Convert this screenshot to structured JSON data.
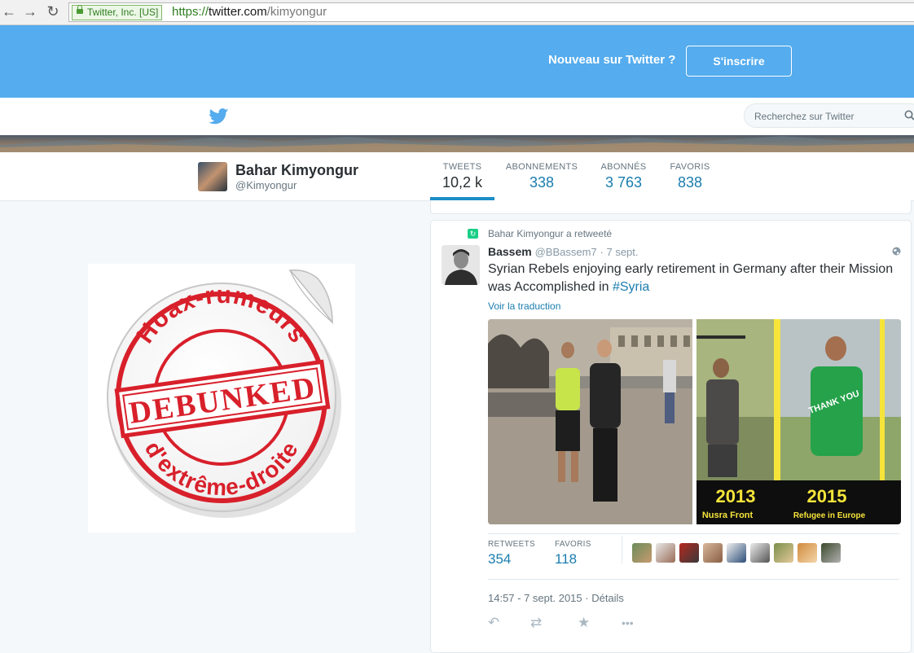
{
  "browser": {
    "ev_badge": "Twitter, Inc. [US]",
    "url_scheme": "https://",
    "url_host": "twitter.com",
    "url_path": "/kimyongur",
    "icons": [
      "back-arrow-icon",
      "forward-arrow-icon",
      "reload-icon",
      "lock-icon"
    ]
  },
  "signup": {
    "prompt": "Nouveau sur Twitter ?",
    "button": "S'inscrire",
    "color": "#55acee"
  },
  "topnav": {
    "search_placeholder": "Recherchez sur Twitter",
    "logo_color": "#55acee"
  },
  "profile": {
    "name": "Bahar Kimyongur",
    "handle": "@Kimyongur",
    "stats": [
      {
        "label": "TWEETS",
        "value": "10,2 k"
      },
      {
        "label": "ABONNEMENTS",
        "value": "338"
      },
      {
        "label": "ABONNÉS",
        "value": "3 763"
      },
      {
        "label": "FAVORIS",
        "value": "838"
      }
    ],
    "active_tab": "TWEETS"
  },
  "sticker": {
    "top_arc": "Hoax-rumeurs",
    "center": "DEBUNKED",
    "bottom_arc": "d'extrême-droite",
    "ink_color": "#d8202b"
  },
  "tweet": {
    "retweet_context": "Bahar Kimyongur a retweeté",
    "author_name": "Bassem",
    "author_handle": "@BBassem7",
    "date": "· 7 sept.",
    "text": "Syrian Rebels enjoying early retirement in Germany after their Mission was Accomplished in ",
    "hashtag": "#Syria",
    "translate": "Voir la traduction",
    "photo2_left_year": "2013",
    "photo2_left_caption": "Nusra Front",
    "photo2_right_year": "2015",
    "photo2_right_caption": "Refugee in Europe",
    "shirt_text": "THANK YOU",
    "retweets_label": "RETWEETS",
    "retweets_value": "354",
    "favorites_label": "FAVORIS",
    "favorites_value": "118",
    "timestamp": "14:57 - 7 sept. 2015 · Détails",
    "actions": [
      "reply-icon",
      "retweet-icon",
      "favorite-icon",
      "more-icon"
    ]
  }
}
